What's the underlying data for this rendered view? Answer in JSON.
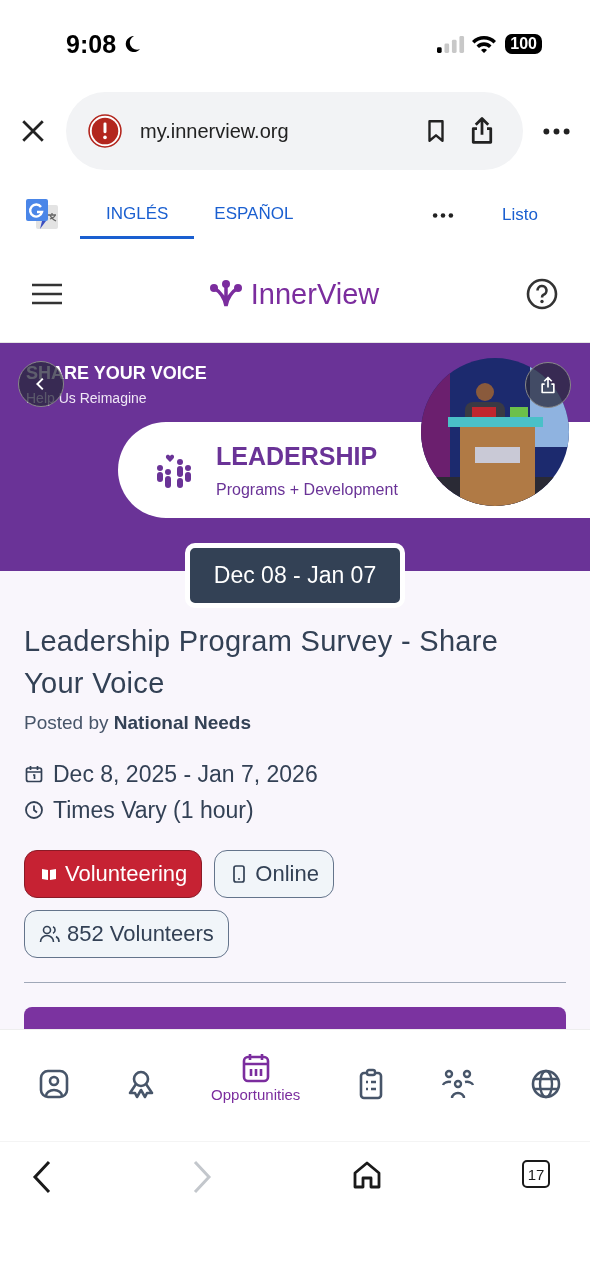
{
  "status_bar": {
    "time": "9:08",
    "battery": "100"
  },
  "browser": {
    "url": "my.innerview.org"
  },
  "translate_bar": {
    "languages": [
      {
        "label": "INGLÉS",
        "selected": true
      },
      {
        "label": "ESPAÑOL",
        "selected": false
      }
    ],
    "done": "Listo"
  },
  "header": {
    "logo_text": "InnerView"
  },
  "banner": {
    "eyebrow": "SHARE YOUR VOICE",
    "subtitle": "Help Us Reimagine",
    "heading": "LEADERSHIP",
    "tagline": "Programs + Development"
  },
  "date_badge": "Dec 08 - Jan 07",
  "opportunity": {
    "title": "Leadership Program Survey - Share Your Voice",
    "posted_by_prefix": "Posted by",
    "poster": "National Needs",
    "dates": "Dec 8, 2025 - Jan 7, 2026",
    "times": "Times Vary (1 hour)",
    "tags": [
      {
        "kind": "category",
        "label": "Volunteering"
      },
      {
        "kind": "online",
        "label": "Online"
      },
      {
        "kind": "volunteers",
        "label": "852 Volunteers"
      }
    ]
  },
  "bottom_nav": [
    {
      "kind": "profile",
      "selected": false
    },
    {
      "kind": "award",
      "selected": false
    },
    {
      "kind": "calendar",
      "label": "Opportunities",
      "selected": true
    },
    {
      "kind": "clipboard",
      "selected": false
    },
    {
      "kind": "group",
      "selected": false
    },
    {
      "kind": "globe",
      "selected": false
    }
  ],
  "browser_toolbar": {
    "back_disabled": false,
    "forward_disabled": true,
    "tab_count": "17"
  }
}
